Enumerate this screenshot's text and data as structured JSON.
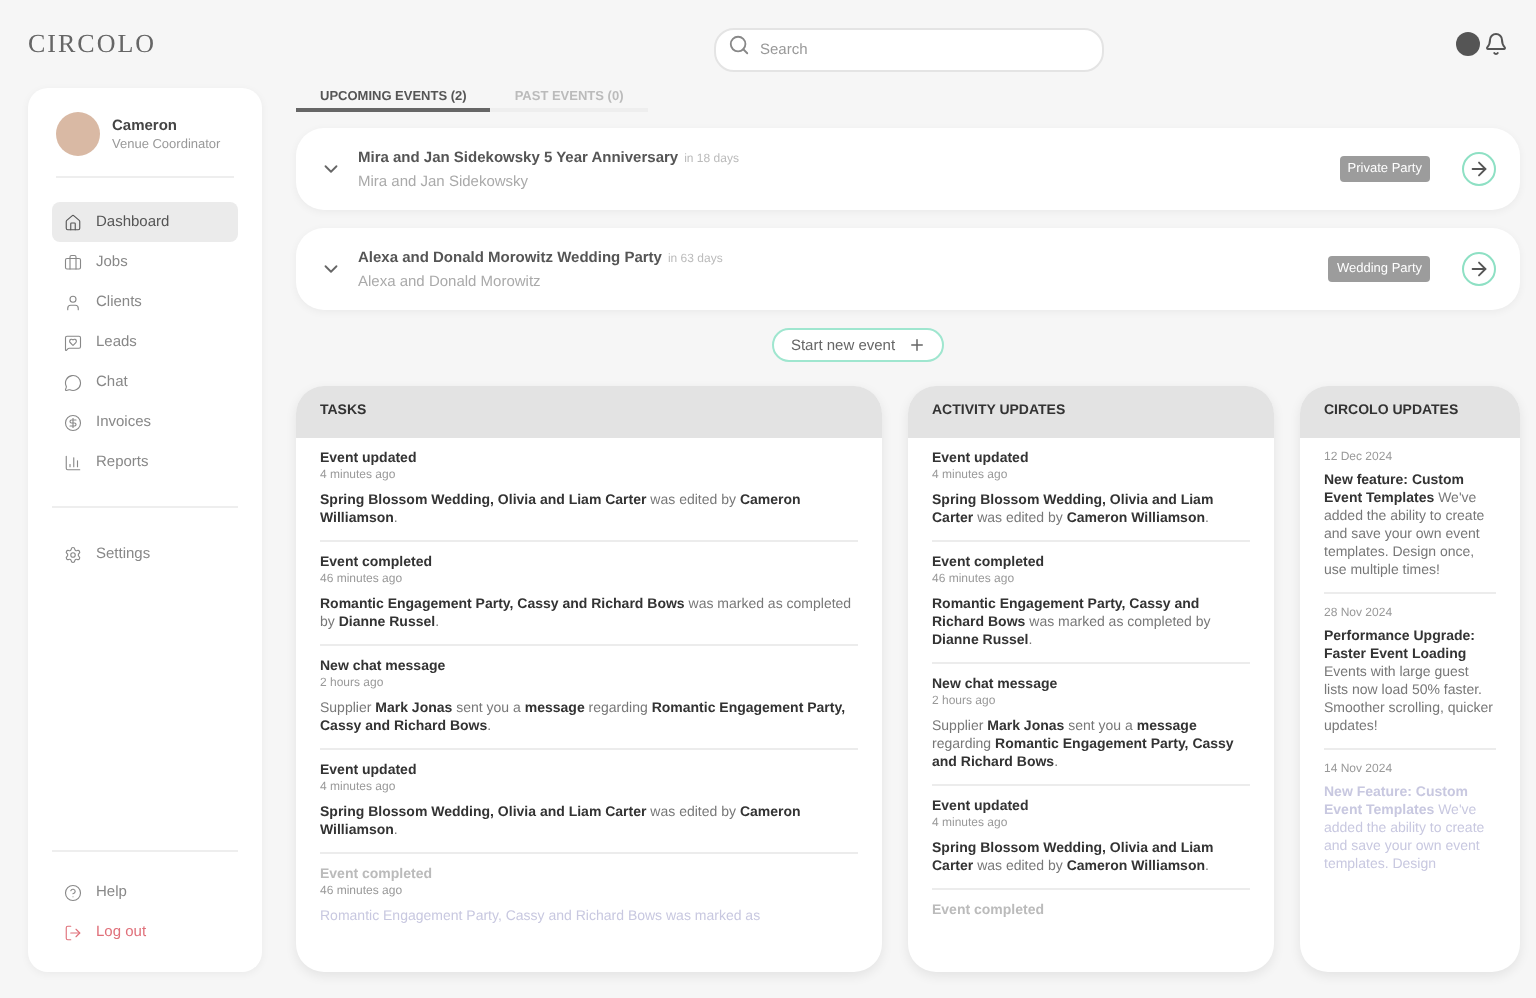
{
  "header": {
    "logo": "CIRCOLO",
    "search": {
      "placeholder": "Search"
    }
  },
  "profile": {
    "name": "Cameron",
    "role": "Venue Coordinator"
  },
  "nav": [
    {
      "label": "Dashboard",
      "selected": true
    },
    {
      "label": "Jobs",
      "selected": false
    },
    {
      "label": "Clients",
      "selected": false
    },
    {
      "label": "Leads",
      "selected": false
    },
    {
      "label": "Chat",
      "selected": false
    },
    {
      "label": "Invoices",
      "selected": false
    },
    {
      "label": "Reports",
      "selected": false
    }
  ],
  "settings": {
    "label": "Settings",
    "selected": false
  },
  "footer_nav": [
    {
      "label": "Help",
      "kind": "normal"
    },
    {
      "label": "Log out",
      "kind": "danger"
    }
  ],
  "tabs": [
    {
      "label": "UPCOMING EVENTS (2)",
      "selected": true
    },
    {
      "label": "PAST EVENTS (0)",
      "selected": false
    }
  ],
  "events": [
    {
      "title": "Mira and Jan Sidekowsky 5 Year Anniversary",
      "due": "in 18 days",
      "subtitle": "Mira and Jan Sidekowsky",
      "tag": "Private Party"
    },
    {
      "title": "Alexa and Donald Morowitz Wedding Party",
      "due": "in 63 days",
      "subtitle": "Alexa and Donald Morowitz",
      "tag": "Wedding Party"
    }
  ],
  "start_button": "Start new event",
  "tasks": {
    "title": "TASKS",
    "items": [
      {
        "title": "Event updated",
        "time": "4 minutes ago",
        "text": "**Spring Blossom Wedding, Olivia and Liam Carter** was edited by **Cameron Williamson**.",
        "faded": false
      },
      {
        "title": "Event completed",
        "time": "46 minutes ago",
        "text": "**Romantic Engagement Party, Cassy and Richard Bows** was marked as completed by **Dianne Russel**.",
        "faded": false
      },
      {
        "title": "New chat message",
        "time": "2 hours ago",
        "text": "Supplier **Mark Jonas** sent you a **message** regarding **Romantic Engagement Party, Cassy and Richard Bows**.",
        "faded": false
      },
      {
        "title": "Event updated",
        "time": "4 minutes ago",
        "text": "**Spring Blossom Wedding, Olivia and Liam Carter** was edited by **Cameron Williamson**.",
        "faded": false
      },
      {
        "title": "Event completed",
        "time": "46 minutes ago",
        "text": "Romantic Engagement Party, Cassy and Richard Bows was marked as",
        "faded": true
      }
    ]
  },
  "activity": {
    "title": "ACTIVITY UPDATES",
    "items": [
      {
        "title": "Event updated",
        "time": "4 minutes ago",
        "text": "**Spring Blossom Wedding, Olivia and Liam Carter** was edited by **Cameron Williamson**.",
        "faded": false
      },
      {
        "title": "Event completed",
        "time": "46 minutes ago",
        "text": "**Romantic Engagement Party, Cassy and Richard Bows** was marked as completed by **Dianne Russel**.",
        "faded": false
      },
      {
        "title": "New chat message",
        "time": "2 hours ago",
        "text": "Supplier **Mark Jonas** sent you a **message** regarding **Romantic Engagement Party, Cassy and Richard Bows**.",
        "faded": false
      },
      {
        "title": "Event updated",
        "time": "4 minutes ago",
        "text": "**Spring Blossom Wedding, Olivia and Liam Carter** was edited by **Cameron Williamson**.",
        "faded": false
      },
      {
        "title": "Event completed",
        "faded": true
      }
    ]
  },
  "circolo": {
    "title": "CIRCOLO UPDATES",
    "items": [
      {
        "date": "12 Dec 2024",
        "text": "**New feature: Custom Event Templates** We've added the ability to create and save your own event templates. Design once, use multiple times!",
        "faded": false
      },
      {
        "date": "28 Nov 2024",
        "text": "**Performance Upgrade: Faster Event Loading** Events with large guest lists now load 50% faster. Smoother scrolling, quicker updates!",
        "faded": false
      },
      {
        "date": "14 Nov 2024",
        "text": "**New Feature: Custom Event Templates** We've added the ability to create and save your own event templates. Design",
        "faded": true
      }
    ]
  }
}
